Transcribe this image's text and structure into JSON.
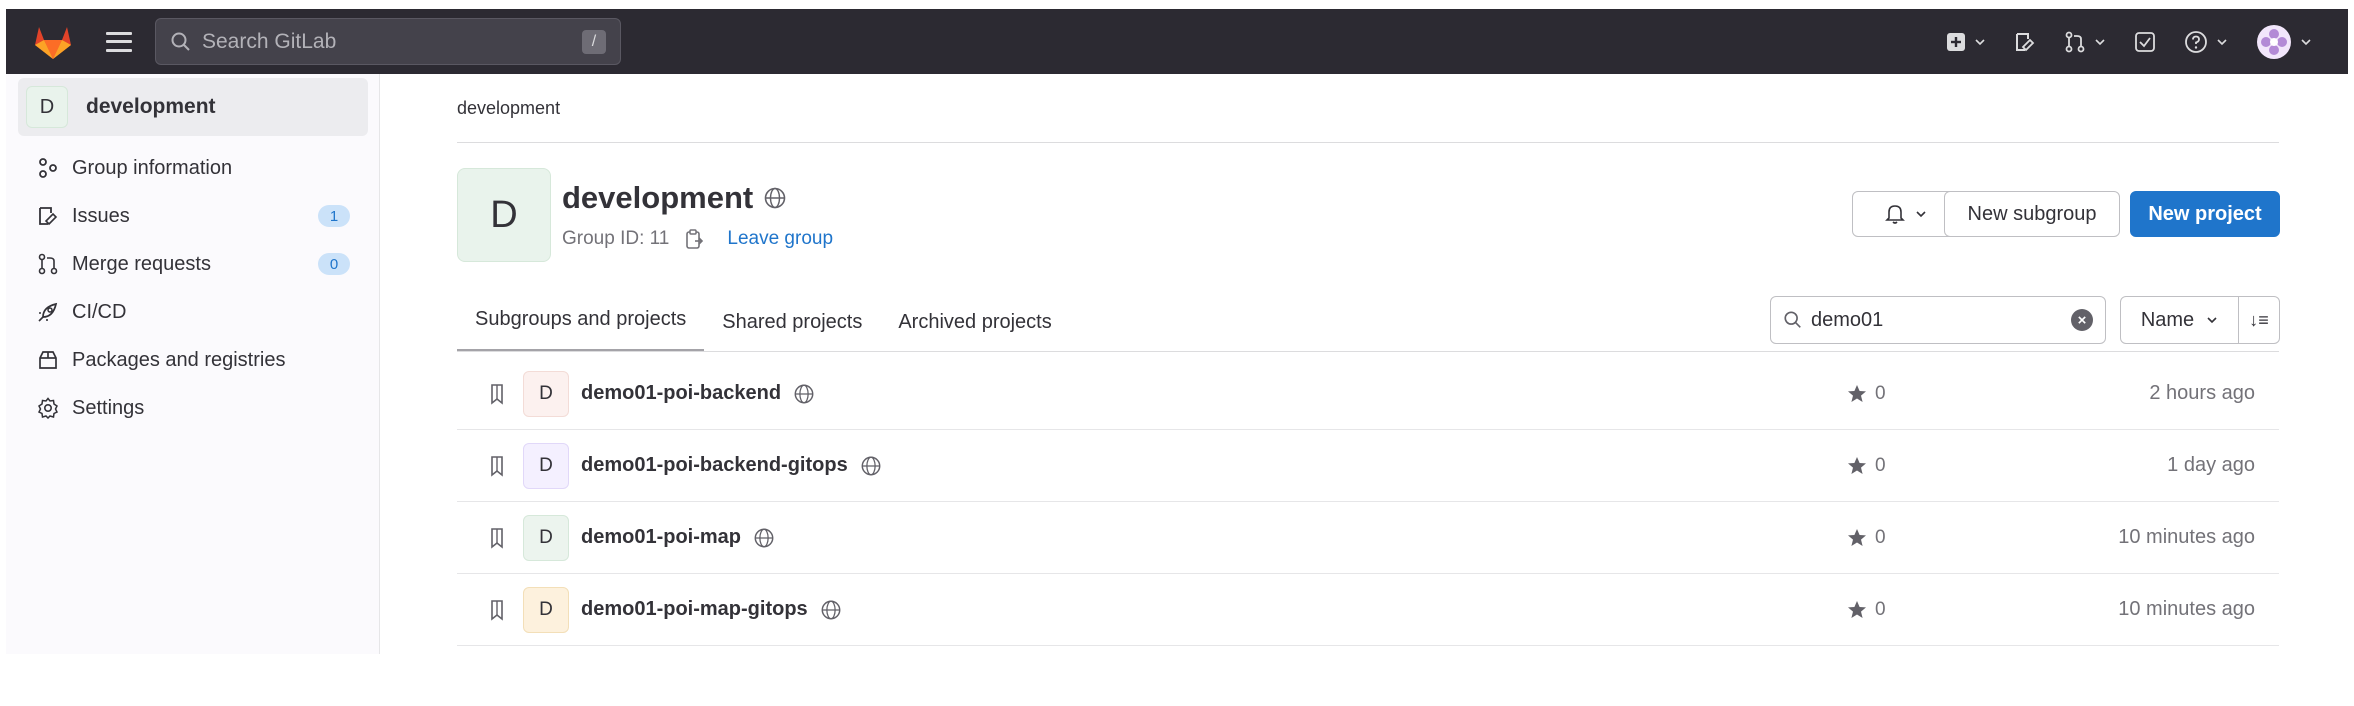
{
  "topbar": {
    "search_placeholder": "Search GitLab",
    "search_shortcut": "/"
  },
  "sidebar": {
    "group_avatar": "D",
    "group_name": "development",
    "items": [
      {
        "label": "Group information",
        "icon": "group-info-icon"
      },
      {
        "label": "Issues",
        "icon": "issues-icon",
        "badge": "1"
      },
      {
        "label": "Merge requests",
        "icon": "merge-request-icon",
        "badge": "0"
      },
      {
        "label": "CI/CD",
        "icon": "rocket-icon"
      },
      {
        "label": "Packages and registries",
        "icon": "package-icon"
      },
      {
        "label": "Settings",
        "icon": "gear-icon"
      }
    ]
  },
  "main": {
    "breadcrumb": "development",
    "avatar": "D",
    "title": "development",
    "group_id": "Group ID: 11",
    "leave_group": "Leave group",
    "new_subgroup": "New subgroup",
    "new_project": "New project",
    "tabs": [
      "Subgroups and projects",
      "Shared projects",
      "Archived projects"
    ],
    "filter_value": "demo01",
    "sort_label": "Name",
    "sort_direction": "↓≡",
    "projects": [
      {
        "avatar": "D",
        "name": "demo01-poi-backend",
        "stars": "0",
        "time": "2 hours ago",
        "color": "#fcf1ef"
      },
      {
        "avatar": "D",
        "name": "demo01-poi-backend-gitops",
        "stars": "0",
        "time": "1 day ago",
        "color": "#f4f0ff"
      },
      {
        "avatar": "D",
        "name": "demo01-poi-map",
        "stars": "0",
        "time": "10 minutes ago",
        "color": "#ecf4ee"
      },
      {
        "avatar": "D",
        "name": "demo01-poi-map-gitops",
        "stars": "0",
        "time": "10 minutes ago",
        "color": "#fdf1dd"
      }
    ]
  },
  "colors": {
    "topbar": "#2c2a32",
    "primary": "#1f75cb",
    "gitlab_orange": "#e24329"
  }
}
